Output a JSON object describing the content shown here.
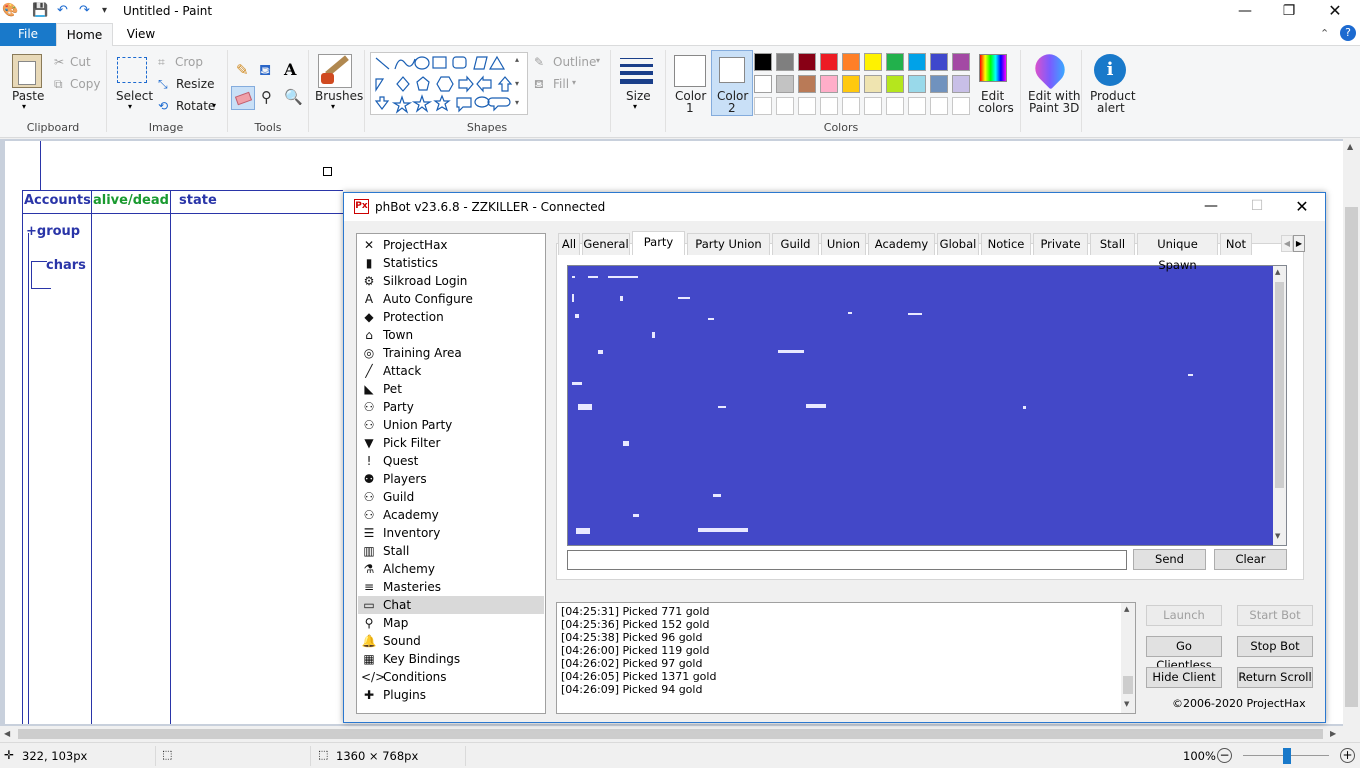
{
  "paint": {
    "title": "Untitled - Paint",
    "tabs": {
      "file": "File",
      "home": "Home",
      "view": "View"
    },
    "clipboard": {
      "paste": "Paste",
      "cut": "Cut",
      "copy": "Copy",
      "group": "Clipboard"
    },
    "image": {
      "select": "Select",
      "crop": "Crop",
      "resize": "Resize",
      "rotate": "Rotate",
      "group": "Image"
    },
    "tools": {
      "group": "Tools"
    },
    "brushes": "Brushes",
    "shapes": {
      "outline": "Outline",
      "fill": "Fill",
      "group": "Shapes"
    },
    "size": "Size",
    "colors": {
      "color1_a": "Color",
      "color1_b": "1",
      "color2_a": "Color",
      "color2_b": "2",
      "edit_a": "Edit",
      "edit_b": "colors",
      "group": "Colors",
      "palette_row1": [
        "#000000",
        "#7f7f7f",
        "#880015",
        "#ed1c24",
        "#ff7f27",
        "#fff200",
        "#22b14c",
        "#00a2e8",
        "#3f48cc",
        "#a349a4"
      ],
      "palette_row2": [
        "#ffffff",
        "#c3c3c3",
        "#b97a57",
        "#ffaec9",
        "#ffc90e",
        "#efe4b0",
        "#b5e61d",
        "#99d9ea",
        "#7092be",
        "#c8bfe7"
      ]
    },
    "paint3d": {
      "a": "Edit with",
      "b": "Paint 3D"
    },
    "product_alert": {
      "a": "Product",
      "b": "alert"
    },
    "canvas_text": {
      "accounts": "Accounts",
      "alive": "alive/dead",
      "state": "state",
      "group": "+group",
      "chars": "chars"
    },
    "status": {
      "cursor": "322, 103px",
      "size": "1360 × 768px",
      "zoom": "100%"
    }
  },
  "bot": {
    "title": "phBot v23.6.8 - ZZKILLER - Connected",
    "nav": [
      "ProjectHax",
      "Statistics",
      "Silkroad Login",
      "Auto Configure",
      "Protection",
      "Town",
      "Training Area",
      "Attack",
      "Pet",
      "Party",
      "Union Party",
      "Pick Filter",
      "Quest",
      "Players",
      "Guild",
      "Academy",
      "Inventory",
      "Stall",
      "Alchemy",
      "Masteries",
      "Chat",
      "Map",
      "Sound",
      "Key Bindings",
      "Conditions",
      "Plugins"
    ],
    "nav_icons": [
      "✕",
      "▮",
      "⚙",
      "A",
      "◆",
      "⌂",
      "◎",
      "╱",
      "◣",
      "⚇",
      "⚇",
      "▼",
      "!",
      "⚉",
      "⚇",
      "⚇",
      "☰",
      "▥",
      "⚗",
      "≡",
      "▭",
      "⚲",
      "🔔",
      "▦",
      "</>",
      "✚"
    ],
    "selected_nav": "Chat",
    "chat_tabs": [
      "All",
      "General",
      "Party",
      "Party Union",
      "Guild",
      "Union",
      "Academy",
      "Global",
      "Notice",
      "Private",
      "Stall",
      "Unique Spawn",
      "Not"
    ],
    "selected_tab": "Party",
    "send": "Send",
    "clear": "Clear",
    "log": [
      "[04:25:31] Picked 771 gold",
      "[04:25:36] Picked 152 gold",
      "[04:25:38] Picked 96 gold",
      "[04:26:00] Picked 119 gold",
      "[04:26:02] Picked 97 gold",
      "[04:26:05] Picked 1371 gold",
      "[04:26:09] Picked 94 gold"
    ],
    "buttons": {
      "launch": "Launch",
      "start": "Start Bot",
      "clientless": "Go Clientless",
      "stop": "Stop Bot",
      "hide": "Hide Client",
      "return": "Return Scroll"
    },
    "copyright": "©2006-2020 ProjectHax"
  }
}
